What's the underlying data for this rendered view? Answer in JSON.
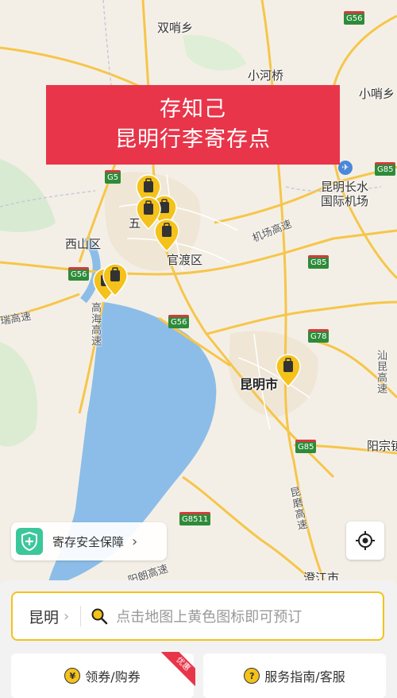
{
  "banner": {
    "line1": "存知己",
    "line2": "昆明行李寄存点"
  },
  "map": {
    "places": {
      "shuangshao": "双哨乡",
      "xiaohe": "小河桥",
      "xiaoshao": "小哨乡",
      "airport": "昆明长水\n国际机场",
      "airport_expressway": "机场高速",
      "wuhua": "五",
      "xishan": "西山区",
      "guandu": "官渡区",
      "gaohai": "高海高速",
      "kunming": "昆明市",
      "shankun": "汕昆高速",
      "yangzong": "阳宗镇",
      "kunmo": "昆磨高速",
      "jingguang": "瑞高速",
      "chengjiang": "澄江市",
      "anning_hint": "阳朗高速"
    },
    "shields": [
      "G56",
      "G5",
      "G56",
      "G85",
      "G56",
      "G78",
      "G85",
      "G8511",
      "G85",
      "G85",
      "G56"
    ]
  },
  "safety": {
    "label": "寄存安全保障"
  },
  "search": {
    "city": "昆明",
    "placeholder": "点击地图上黄色图标即可预订"
  },
  "actions": {
    "coupon_label": "领券/购券",
    "coupon_icon_glyph": "¥",
    "coupon_badge": "优惠",
    "guide_label": "服务指南/客服",
    "guide_icon_glyph": "?"
  },
  "colors": {
    "brand_yellow": "#f4c21a",
    "banner_red": "#e8354a",
    "lake": "#8cbde8"
  }
}
